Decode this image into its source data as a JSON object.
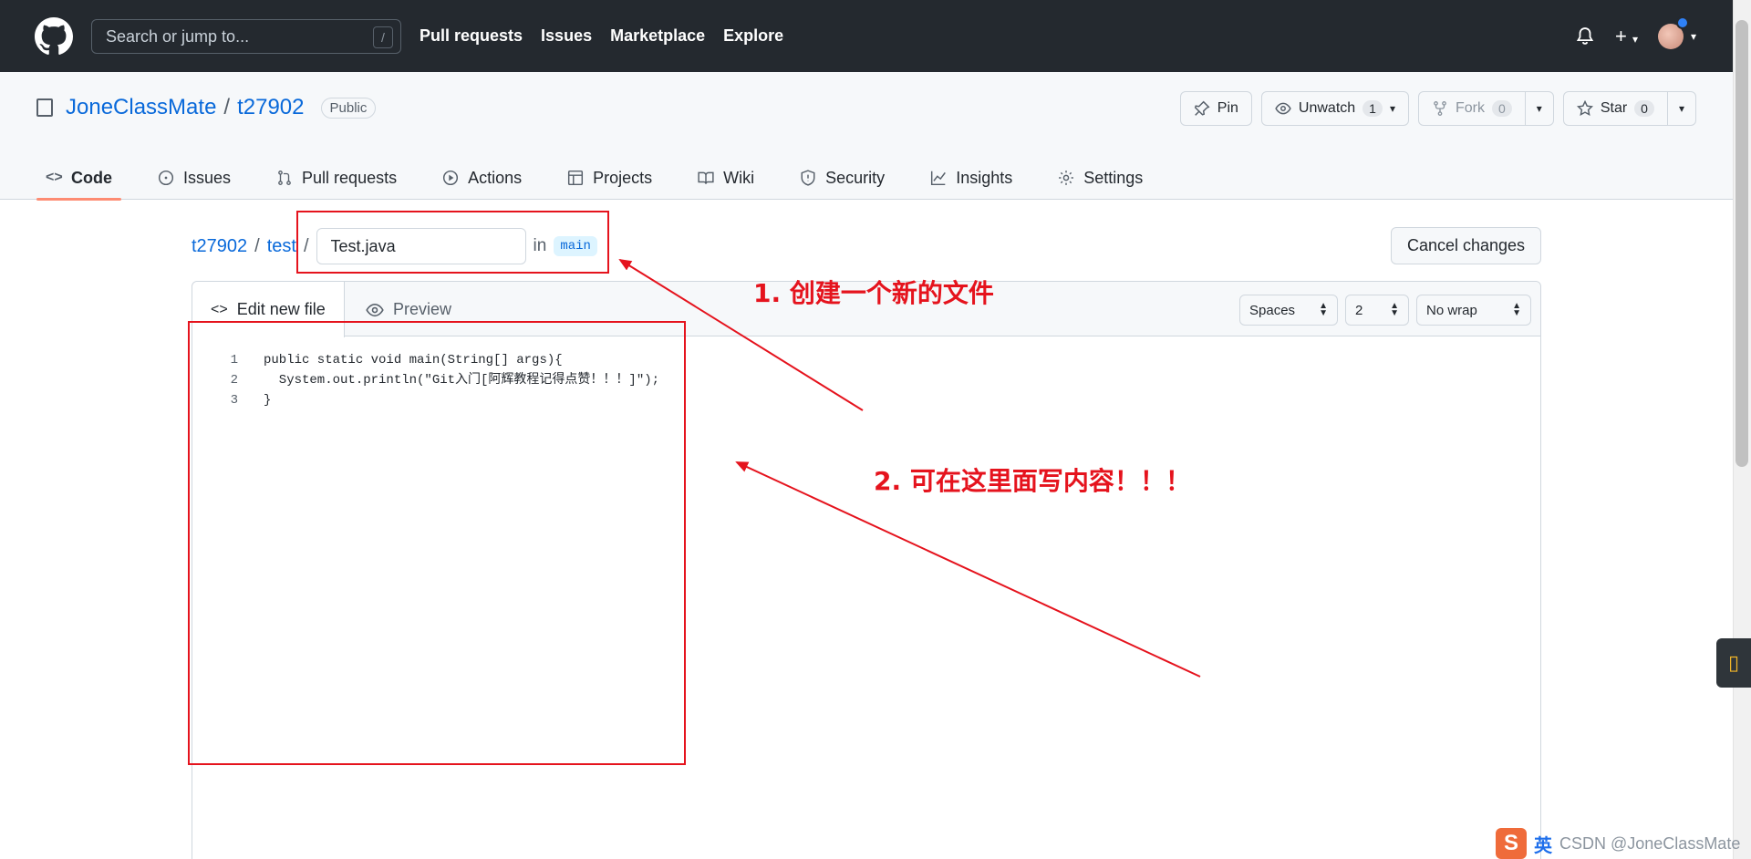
{
  "header": {
    "search_placeholder": "Search or jump to...",
    "search_shortcut": "/",
    "nav": [
      "Pull requests",
      "Issues",
      "Marketplace",
      "Explore"
    ],
    "plus": "+"
  },
  "repo": {
    "owner": "JoneClassMate",
    "sep": "/",
    "name": "t27902",
    "visibility": "Public",
    "pin_label": "Pin",
    "unwatch_label": "Unwatch",
    "watch_count": "1",
    "fork_label": "Fork",
    "fork_count": "0",
    "star_label": "Star",
    "star_count": "0",
    "tabs": [
      "Code",
      "Issues",
      "Pull requests",
      "Actions",
      "Projects",
      "Wiki",
      "Security",
      "Insights",
      "Settings"
    ]
  },
  "breadcrumb": {
    "repo": "t27902",
    "sep1": "/",
    "folder": "test",
    "sep2": "/",
    "filename": "Test.java",
    "in": "in",
    "branch": "main"
  },
  "cancel_label": "Cancel changes",
  "editor": {
    "tab_edit": "Edit new file",
    "tab_preview": "Preview",
    "indent_mode": "Spaces",
    "indent_size": "2",
    "wrap_mode": "No wrap",
    "lines": [
      {
        "n": "1",
        "text": "public static void main(String[] args){"
      },
      {
        "n": "2",
        "text": "  System.out.println(\"Git入门[阿辉教程记得点赞！！！]\");"
      },
      {
        "n": "3",
        "text": "}"
      }
    ]
  },
  "annotations": {
    "note1": "1. 创建一个新的文件",
    "note2": "2. 可在这里面写内容！！！",
    "color": "#e5131d"
  },
  "watermark": {
    "logo": "S",
    "ime": "英",
    "text": "CSDN @JoneClassMate"
  }
}
